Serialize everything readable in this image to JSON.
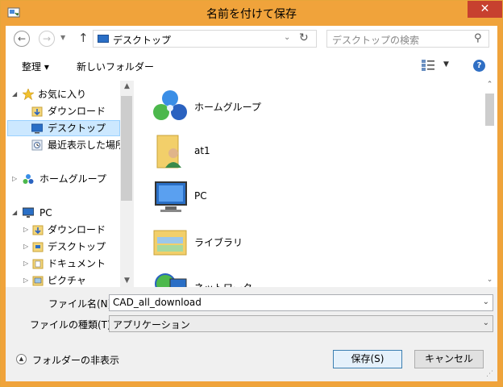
{
  "window": {
    "title": "名前を付けて保存",
    "close_glyph": "✕"
  },
  "nav": {
    "back": "←",
    "forward": "→",
    "up": "↑",
    "address": "デスクトップ",
    "address_chevron": "›",
    "refresh": "↻",
    "search_placeholder": "デスクトップの検索"
  },
  "toolbar": {
    "organize": "整理 ▾",
    "new_folder": "新しいフォルダー",
    "help": "?"
  },
  "left_nav": [
    {
      "label": "お気に入り",
      "icon": "star-icon",
      "expander": "◢"
    },
    {
      "label": "ダウンロード",
      "icon": "downloads-folder-icon"
    },
    {
      "label": "デスクトップ",
      "icon": "desktop-icon",
      "selected": true
    },
    {
      "label": "最近表示した場所",
      "icon": "recent-places-icon"
    },
    {
      "label": "ホームグループ",
      "icon": "homegroup-icon",
      "expander": "▷"
    },
    {
      "label": "PC",
      "icon": "pc-icon",
      "expander": "◢"
    },
    {
      "label": "ダウンロード",
      "icon": "downloads-folder-icon",
      "expander": "▷"
    },
    {
      "label": "デスクトップ",
      "icon": "desktop-folder-icon",
      "expander": "▷"
    },
    {
      "label": "ドキュメント",
      "icon": "documents-folder-icon",
      "expander": "▷"
    },
    {
      "label": "ピクチャ",
      "icon": "pictures-folder-icon",
      "expander": "▷"
    }
  ],
  "items": [
    {
      "label": "ホームグループ",
      "icon": "homegroup-icon"
    },
    {
      "label": "at1",
      "icon": "user-folder-icon"
    },
    {
      "label": "PC",
      "icon": "pc-icon"
    },
    {
      "label": "ライブラリ",
      "icon": "libraries-icon"
    },
    {
      "label": "ネットワーク",
      "icon": "network-icon"
    }
  ],
  "form": {
    "filename_label": "ファイル名(N):",
    "filename_value": "CAD_all_download",
    "filetype_label": "ファイルの種類(T):",
    "filetype_value": "アプリケーション",
    "dropdown_glyph": "⌄"
  },
  "footer": {
    "hide_folders": "フォルダーの非表示",
    "save": "保存(S)",
    "cancel": "キャンセル"
  },
  "colors": {
    "title_bar": "#f0a33b",
    "close_button": "#c7402f",
    "selection": "#cce8ff"
  }
}
